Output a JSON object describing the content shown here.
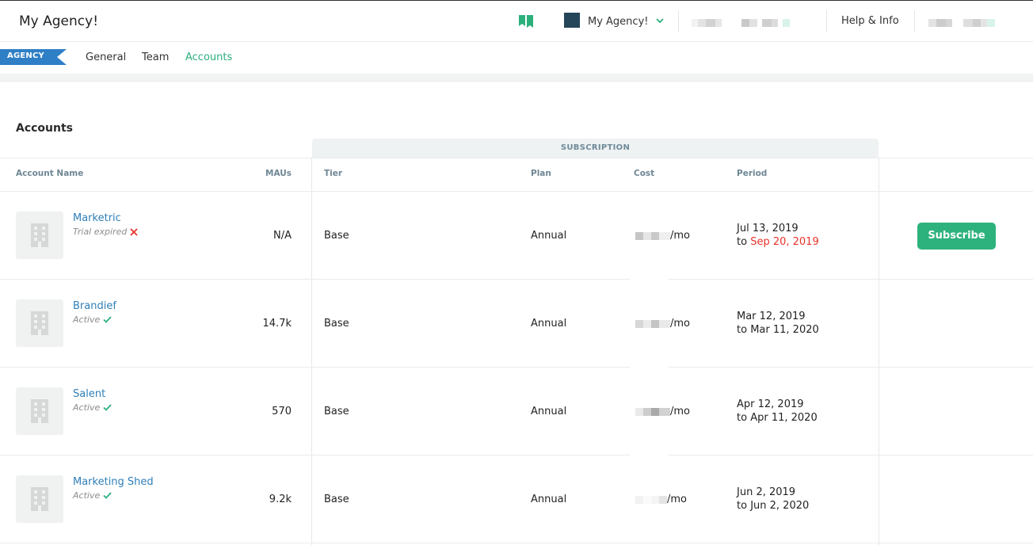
{
  "header": {
    "app_title": "My Agency!",
    "org_name": "My Agency!",
    "help_label": "Help & Info",
    "brand_color": "#2bb07c",
    "org_color": "#254559"
  },
  "subnav": {
    "badge": "AGENCY",
    "badge_color": "#2f7fc6",
    "tabs": [
      {
        "label": "General",
        "active": false
      },
      {
        "label": "Team",
        "active": false
      },
      {
        "label": "Accounts",
        "active": true
      }
    ]
  },
  "accounts": {
    "title": "Accounts",
    "subscription_header": "SUBSCRIPTION",
    "columns": {
      "account_name": "Account Name",
      "maus": "MAUs",
      "tier": "Tier",
      "plan": "Plan",
      "cost": "Cost",
      "period": "Period"
    },
    "rows": [
      {
        "name": "Marketric",
        "status": "Trial expired",
        "status_icon": "x-icon",
        "maus": "N/A",
        "tier": "Base",
        "plan": "Annual",
        "cost_suffix": "/mo",
        "period_from": "Jul 13, 2019",
        "period_to_prefix": "to",
        "period_to": "Sep 20, 2019",
        "period_to_expired": true,
        "action": "Subscribe"
      },
      {
        "name": "Brandief",
        "status": "Active",
        "status_icon": "check-icon",
        "maus": "14.7k",
        "tier": "Base",
        "plan": "Annual",
        "cost_suffix": "/mo",
        "period_from": "Mar 12, 2019",
        "period_to_prefix": "to",
        "period_to": "Mar 11, 2020",
        "period_to_expired": false
      },
      {
        "name": "Salent",
        "status": "Active",
        "status_icon": "check-icon",
        "maus": "570",
        "tier": "Base",
        "plan": "Annual",
        "cost_suffix": "/mo",
        "period_from": "Apr 12, 2019",
        "period_to_prefix": "to",
        "period_to": "Apr 11, 2020",
        "period_to_expired": false
      },
      {
        "name": "Marketing Shed",
        "status": "Active",
        "status_icon": "check-icon",
        "maus": "9.2k",
        "tier": "Base",
        "plan": "Annual",
        "cost_suffix": "/mo",
        "period_from": "Jun 2, 2019",
        "period_to_prefix": "to",
        "period_to": "Jun 2, 2020",
        "period_to_expired": false
      }
    ]
  }
}
